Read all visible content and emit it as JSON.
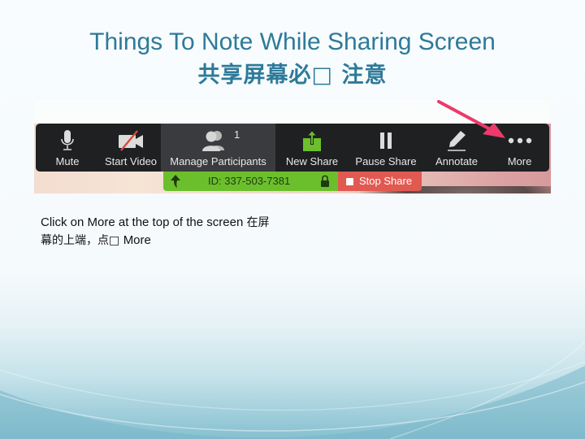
{
  "slide": {
    "title": "Things To Note While Sharing Screen",
    "title_cn": "共享屏幕必□ 注意",
    "body_en": "Click on More at the top of the screen ",
    "body_cn_1": " 在屏",
    "body_cn_2": "幕的上端，点□ ",
    "body_en_2": "More"
  },
  "zoom_toolbar": {
    "buttons": [
      {
        "label": "Mute",
        "icon": "microphone-icon"
      },
      {
        "label": "Start Video",
        "icon": "video-off-icon"
      },
      {
        "label": "Manage Participants",
        "icon": "participants-icon",
        "badge": "1",
        "active": true
      },
      {
        "label": "New Share",
        "icon": "share-upload-icon"
      },
      {
        "label": "Pause Share",
        "icon": "pause-icon"
      },
      {
        "label": "Annotate",
        "icon": "pencil-icon"
      },
      {
        "label": "More",
        "icon": "more-dots-icon"
      }
    ],
    "meeting_id": "ID: 337-503-7381",
    "stop_share_label": "Stop Share"
  },
  "colors": {
    "title": "#2e7a99",
    "toolbar_bg": "#1f2022",
    "share_green": "#6cbf2c",
    "stop_red": "#e05a52",
    "pointer_arrow": "#ec3a6b"
  }
}
